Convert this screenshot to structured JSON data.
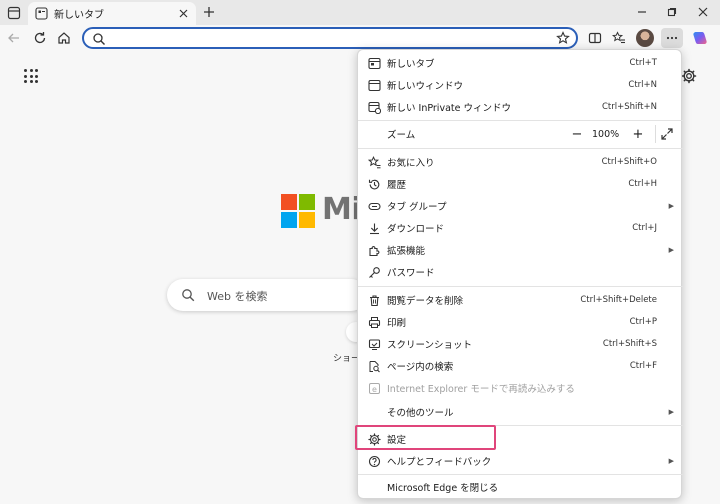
{
  "tab": {
    "title": "新しいタブ"
  },
  "address": {
    "value": "",
    "placeholder": ""
  },
  "page": {
    "brand_text": "Mic",
    "search_placeholder": "Web を検索",
    "shortcut_label": "ショー"
  },
  "menu": {
    "new_tab": {
      "label": "新しいタブ",
      "shortcut": "Ctrl+T"
    },
    "new_window": {
      "label": "新しいウィンドウ",
      "shortcut": "Ctrl+N"
    },
    "new_inprivate": {
      "label": "新しい InPrivate ウィンドウ",
      "shortcut": "Ctrl+Shift+N"
    },
    "zoom": {
      "label": "ズーム",
      "minus": "−",
      "value": "100%",
      "plus": "+"
    },
    "favorites": {
      "label": "お気に入り",
      "shortcut": "Ctrl+Shift+O"
    },
    "history": {
      "label": "履歴",
      "shortcut": "Ctrl+H"
    },
    "tab_groups": {
      "label": "タブ グループ"
    },
    "downloads": {
      "label": "ダウンロード",
      "shortcut": "Ctrl+J"
    },
    "extensions": {
      "label": "拡張機能"
    },
    "passwords": {
      "label": "パスワード"
    },
    "clear_data": {
      "label": "閲覧データを削除",
      "shortcut": "Ctrl+Shift+Delete"
    },
    "print": {
      "label": "印刷",
      "shortcut": "Ctrl+P"
    },
    "screenshot": {
      "label": "スクリーンショット",
      "shortcut": "Ctrl+Shift+S"
    },
    "find": {
      "label": "ページ内の検索",
      "shortcut": "Ctrl+F"
    },
    "ie_mode": {
      "label": "Internet Explorer モードで再読み込みする"
    },
    "more_tools": {
      "label": "その他のツール"
    },
    "settings": {
      "label": "設定"
    },
    "help": {
      "label": "ヘルプとフィードバック"
    },
    "close_edge": {
      "label": "Microsoft Edge を閉じる"
    }
  },
  "colors": {
    "address_border": "#2b5fb8",
    "highlight": "#e0457b",
    "ms_red": "#f25022",
    "ms_green": "#7fba00",
    "ms_blue": "#00a4ef",
    "ms_yellow": "#ffb900"
  }
}
